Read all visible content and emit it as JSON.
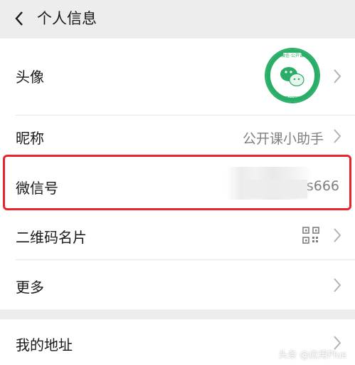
{
  "header": {
    "title": "个人信息",
    "back_icon": "chevron-left-icon"
  },
  "rows": {
    "avatar": {
      "label": "头像",
      "logo_text": [
        "微信·公开课",
        "WECHAT OPEN CLASS"
      ]
    },
    "nickname": {
      "label": "昵称",
      "value": "公开课小助手"
    },
    "wechat_id": {
      "label": "微信号",
      "value": "s666"
    },
    "qr_card": {
      "label": "二维码名片",
      "icon": "qr-code-icon"
    },
    "more": {
      "label": "更多"
    },
    "address": {
      "label": "我的地址"
    }
  },
  "watermark": "头条 @应用Plus",
  "colors": {
    "background": "#ededed",
    "card": "#ffffff",
    "highlight": "#e8262a",
    "logo_green": "#2aae67"
  }
}
